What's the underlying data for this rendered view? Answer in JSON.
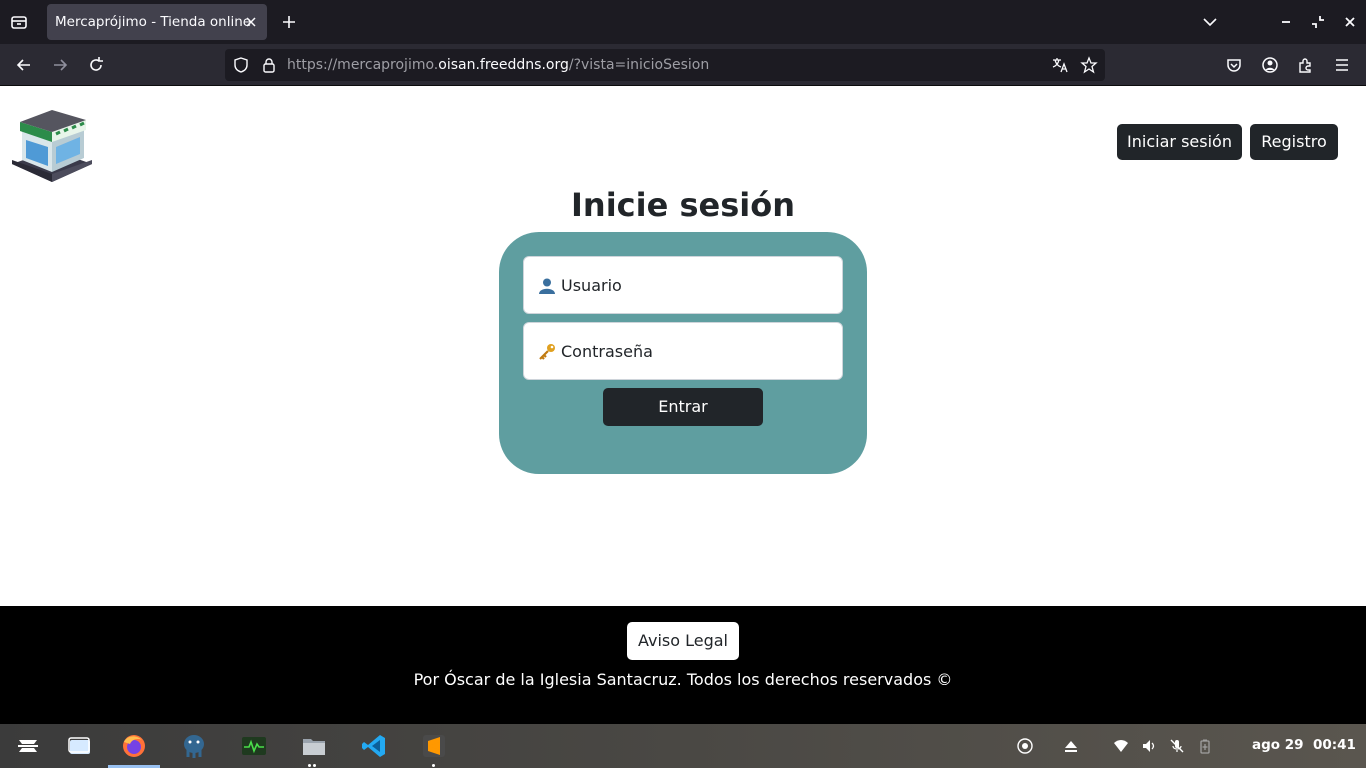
{
  "browser": {
    "tab_title": "Mercaprójimo - Tienda online",
    "url": {
      "prefix": "https://mercaprojimo.",
      "host": "oisan.freeddns.org",
      "suffix": "/?vista=inicioSesion"
    }
  },
  "header": {
    "login_label": "Iniciar sesión",
    "register_label": "Registro"
  },
  "login": {
    "title": "Inicie sesión",
    "username_placeholder": "Usuario",
    "password_placeholder": "Contraseña",
    "submit_label": "Entrar"
  },
  "footer": {
    "legal_label": "Aviso Legal",
    "copyright": "Por Óscar de la Iglesia Santacruz. Todos los derechos reservados ©"
  },
  "taskbar": {
    "clock_date": "ago 29",
    "clock_time": "00:41"
  },
  "colors": {
    "card": "#5f9ea0",
    "dark_button": "#212529",
    "footer": "#000000"
  }
}
